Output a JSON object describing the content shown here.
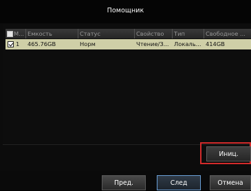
{
  "window": {
    "title": "Помощник"
  },
  "table": {
    "columns": [
      "М...",
      "Емкость",
      "Статус",
      "Свойство",
      "Тип",
      "Свободное ..."
    ],
    "rows": [
      {
        "index": "1",
        "capacity": "465.76GB",
        "status": "Норм",
        "property": "Чтение/З...",
        "type": "Локаль...",
        "free": "414GB"
      }
    ]
  },
  "buttons": {
    "init": "Иниц.",
    "prev": "Пред.",
    "next": "След",
    "cancel": "Отмена"
  },
  "colors": {
    "selected_row": "#cfcfa7",
    "highlight_border": "#d42b2b",
    "focused_button": "#6aa0d8"
  }
}
